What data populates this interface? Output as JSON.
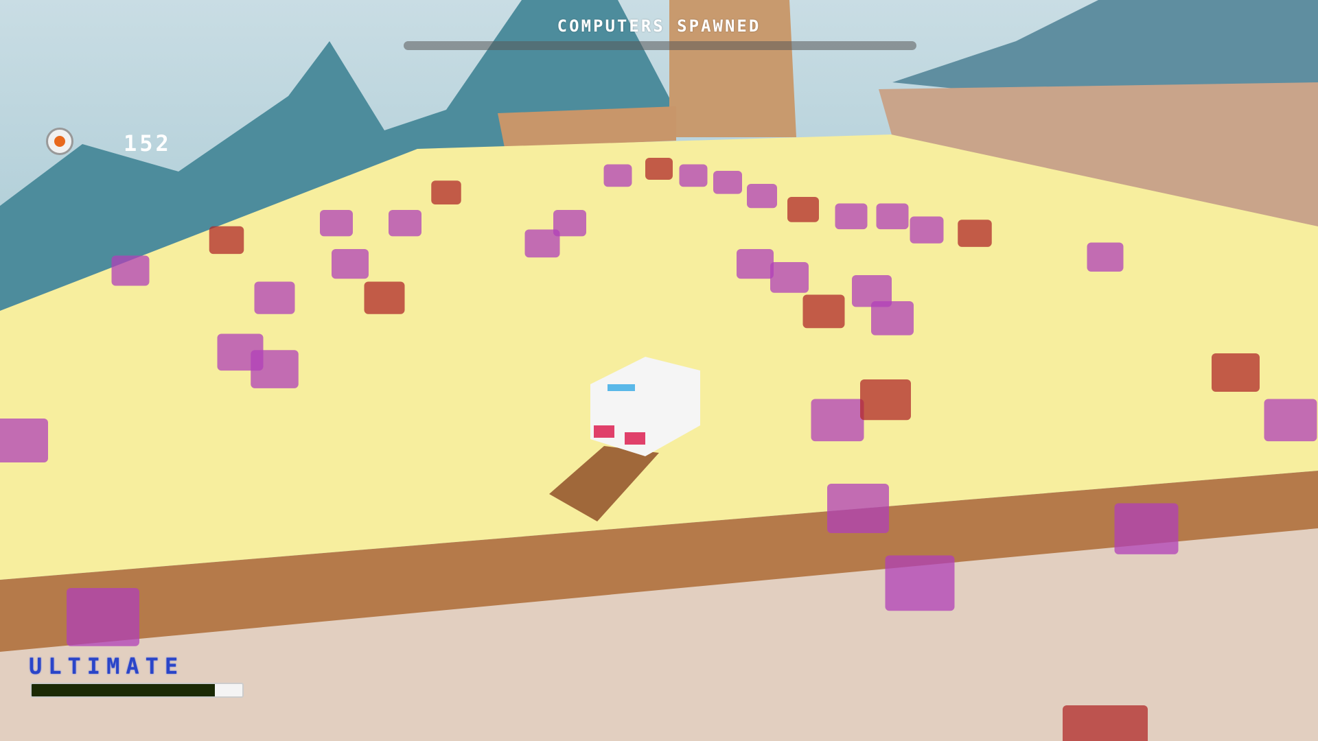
{
  "hud": {
    "progress_title": "COMPUTERS SPAWNED",
    "progress_fraction": 0,
    "coin_icon": "coin-icon",
    "coin_count": "152",
    "ultimate_label": "ULTIMATE",
    "ultimate_fraction": 0.87
  },
  "colors": {
    "platform": "#f7ee9e",
    "platform_side": "#b57a4a",
    "computer_purple": "#b040b8",
    "computer_red": "#b02a2a",
    "ultimate_text": "#2a45c8",
    "coin": "#e8681c"
  }
}
